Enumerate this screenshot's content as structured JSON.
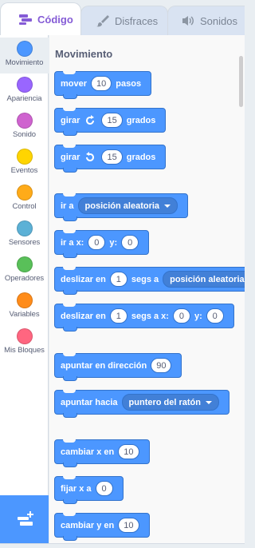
{
  "tabs": [
    {
      "label": "Código",
      "icon": "code-icon"
    },
    {
      "label": "Disfraces",
      "icon": "brush-icon"
    },
    {
      "label": "Sonidos",
      "icon": "speaker-icon"
    }
  ],
  "categories": [
    {
      "label": "Movimiento",
      "color": "#4c97ff"
    },
    {
      "label": "Apariencia",
      "color": "#9966ff"
    },
    {
      "label": "Sonido",
      "color": "#cf63cf"
    },
    {
      "label": "Eventos",
      "color": "#ffd500"
    },
    {
      "label": "Control",
      "color": "#ffab19"
    },
    {
      "label": "Sensores",
      "color": "#5cb1d6"
    },
    {
      "label": "Operadores",
      "color": "#59c059"
    },
    {
      "label": "Variables",
      "color": "#ff8c1a"
    },
    {
      "label": "Mis Bloques",
      "color": "#ff6680"
    }
  ],
  "extension_button": {
    "icon": "add-extension-icon"
  },
  "palette": {
    "section_title": "Movimiento",
    "blocks": {
      "move": {
        "t1": "mover",
        "v1": "10",
        "t2": "pasos"
      },
      "turn_right": {
        "t1": "girar",
        "v1": "15",
        "t2": "grados"
      },
      "turn_left": {
        "t1": "girar",
        "v1": "15",
        "t2": "grados"
      },
      "goto": {
        "t1": "ir a",
        "d1": "posición aleatoria"
      },
      "goto_xy": {
        "t1": "ir a x:",
        "v1": "0",
        "t2": "y:",
        "v2": "0"
      },
      "glide_to": {
        "t1": "deslizar en",
        "v1": "1",
        "t2": "segs a",
        "d1": "posición aleatoria"
      },
      "glide_xy": {
        "t1": "deslizar en",
        "v1": "1",
        "t2": "segs a x:",
        "v2": "0",
        "t3": "y:",
        "v3": "0"
      },
      "point_dir": {
        "t1": "apuntar en dirección",
        "v1": "90"
      },
      "point_towards": {
        "t1": "apuntar hacia",
        "d1": "puntero del ratón"
      },
      "change_x": {
        "t1": "cambiar x en",
        "v1": "10"
      },
      "set_x": {
        "t1": "fijar x a",
        "v1": "0"
      },
      "change_y": {
        "t1": "cambiar y en",
        "v1": "10"
      }
    }
  },
  "colors": {
    "accent": "#855cd6",
    "motion": "#4c97ff",
    "motion_border": "#3373cc"
  }
}
